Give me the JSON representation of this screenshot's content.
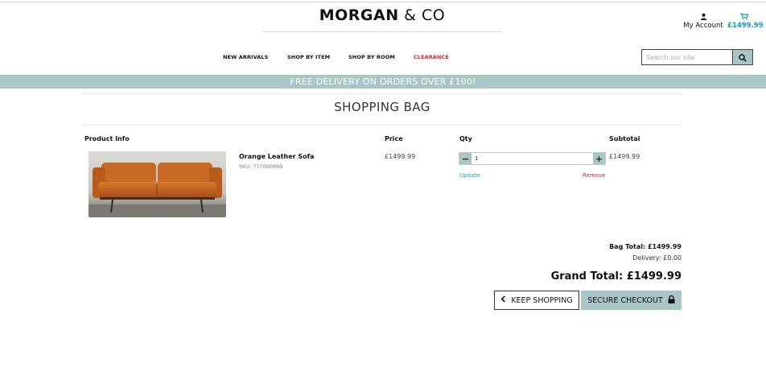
{
  "brand": {
    "name_bold": "MORGAN",
    "name_rest": " & CO"
  },
  "account": {
    "label": "My Account",
    "icon": "user-icon"
  },
  "cart": {
    "amount": "£1499.99",
    "icon": "cart-icon"
  },
  "nav": {
    "items": [
      {
        "label": "NEW ARRIVALS"
      },
      {
        "label": "SHOP BY ITEM"
      },
      {
        "label": "SHOP BY ROOM"
      },
      {
        "label": "CLEARANCE"
      }
    ]
  },
  "search": {
    "placeholder": "Search our site",
    "icon": "search-icon"
  },
  "banner": {
    "text": "FREE DELIVERY ON ORDERS OVER £100!"
  },
  "page": {
    "title": "SHOPPING BAG"
  },
  "table": {
    "headers": {
      "product": "Product Info",
      "price": "Price",
      "qty": "Qty",
      "subtotal": "Subtotal"
    },
    "rows": [
      {
        "name": "Orange Leather Sofa",
        "sku": "SKU: 777000999",
        "price": "£1499.99",
        "qty": "1",
        "update": "Update",
        "remove": "Remove",
        "subtotal": "£1499.99"
      }
    ]
  },
  "totals": {
    "bag": "Bag Total: £1499.99",
    "delivery": "Delivery: £0.00",
    "grand": "Grand Total: £1499.99"
  },
  "buttons": {
    "keep_shopping": "KEEP SHOPPING",
    "checkout": "SECURE CHECKOUT"
  },
  "colors": {
    "accent": "#a9c6c6",
    "link": "#1a9ac5",
    "clearance": "#d8262f"
  }
}
